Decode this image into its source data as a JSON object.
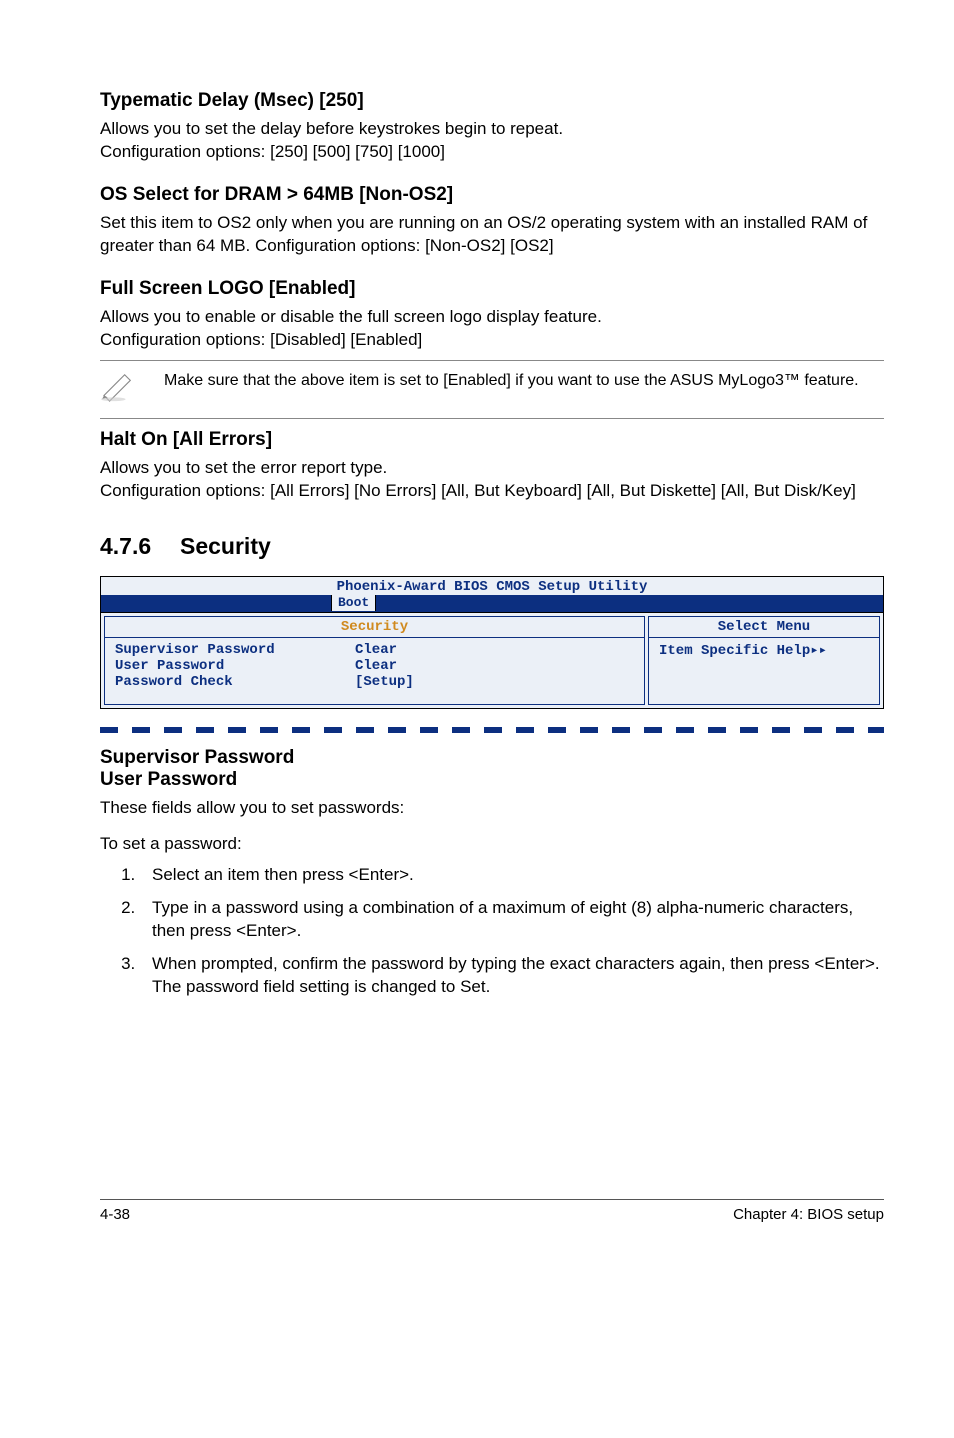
{
  "sec1": {
    "title": "Typematic Delay (Msec) [250]",
    "p1": "Allows you to set the delay before keystrokes begin to repeat.",
    "p2": "Configuration options: [250] [500] [750] [1000]"
  },
  "sec2": {
    "title": "OS Select for DRAM > 64MB [Non-OS2]",
    "p1": "Set this item to OS2 only when you are running on an OS/2 operating system with an installed RAM of greater than 64 MB. Configuration options: [Non-OS2] [OS2]"
  },
  "sec3": {
    "title": "Full Screen LOGO [Enabled]",
    "p1": "Allows you to enable or disable the full screen logo display feature.",
    "p2": "Configuration options: [Disabled] [Enabled]"
  },
  "note": {
    "text": "Make sure that the above item is set to [Enabled] if you want to use the ASUS MyLogo3™ feature."
  },
  "sec4": {
    "title": "Halt On [All Errors]",
    "p1": "Allows you to set the error report type.",
    "p2": "Configuration options: [All Errors] [No Errors] [All, But Keyboard] [All, But Diskette] [All, But Disk/Key]"
  },
  "numbered": {
    "num": "4.7.6",
    "title": "Security"
  },
  "bios": {
    "title": "Phoenix-Award BIOS CMOS Setup Utility",
    "tab": "Boot",
    "left_header": "Security",
    "right_header": "Select Menu",
    "rows": [
      {
        "k": "Supervisor Password",
        "v": "Clear"
      },
      {
        "k": "User Password",
        "v": "Clear"
      },
      {
        "k": "Password Check",
        "v": "[Setup]"
      }
    ],
    "right_text": "Item Specific Help▸▸"
  },
  "sec5": {
    "title1": "Supervisor Password",
    "title2": "User Password",
    "p1": "These fields allow you to set passwords:",
    "p2": "To set a password:"
  },
  "steps": [
    "Select an item then press <Enter>.",
    "Type in a password using a combination of a maximum of eight (8) alpha-numeric characters, then press <Enter>.",
    "When prompted, confirm the password by typing the exact characters again, then press <Enter>. The password field setting is changed to Set."
  ],
  "footer": {
    "left": "4-38",
    "right": "Chapter 4: BIOS setup"
  }
}
